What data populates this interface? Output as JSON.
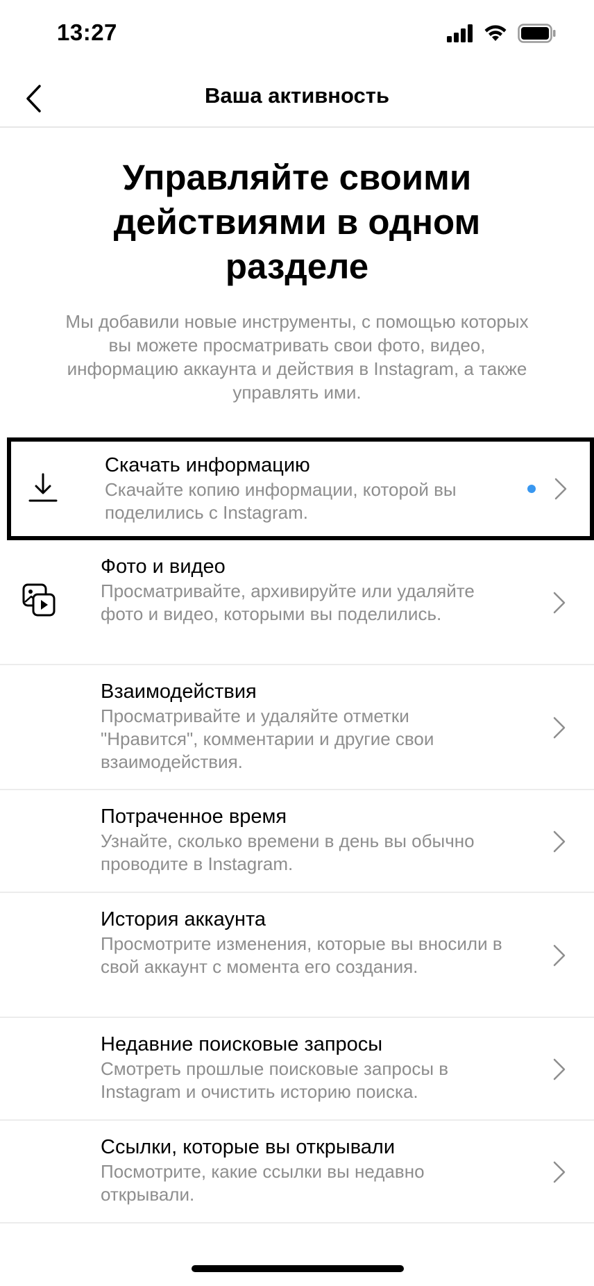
{
  "status": {
    "time": "13:27"
  },
  "nav": {
    "title": "Ваша активность"
  },
  "intro": {
    "title": "Управляйте своими действиями в одном разделе",
    "text": "Мы добавили новые инструменты, с помощью которых вы можете просматривать свои фото, видео, информацию аккаунта и действия в Instagram, а также управлять ими."
  },
  "items": [
    {
      "title": "Скачать информацию",
      "desc": "Скачайте копию информации, которой вы поделились с Instagram.",
      "icon": "download-icon"
    },
    {
      "title": "Фото и видео",
      "desc": "Просматривайте, архивируйте или удаляйте фото и видео, которыми вы поделились.",
      "icon": "photo-video-icon"
    },
    {
      "title": "Взаимодействия",
      "desc": "Просматривайте и удаляйте отметки \"Нравится\", комментарии и другие свои взаимодействия."
    },
    {
      "title": "Потраченное время",
      "desc": "Узнайте, сколько времени в день вы обычно проводите в Instagram."
    },
    {
      "title": "История аккаунта",
      "desc": "Просмотрите изменения, которые вы вносили в свой аккаунт с момента его создания."
    },
    {
      "title": "Недавние поисковые запросы",
      "desc": "Смотреть прошлые поисковые запросы в Instagram и очистить историю поиска."
    },
    {
      "title": "Ссылки, которые вы открывали",
      "desc": "Посмотрите, какие ссылки вы недавно открывали."
    }
  ],
  "colors": {
    "accent_dot": "#3897f0",
    "muted_text": "#8e8e8e"
  }
}
